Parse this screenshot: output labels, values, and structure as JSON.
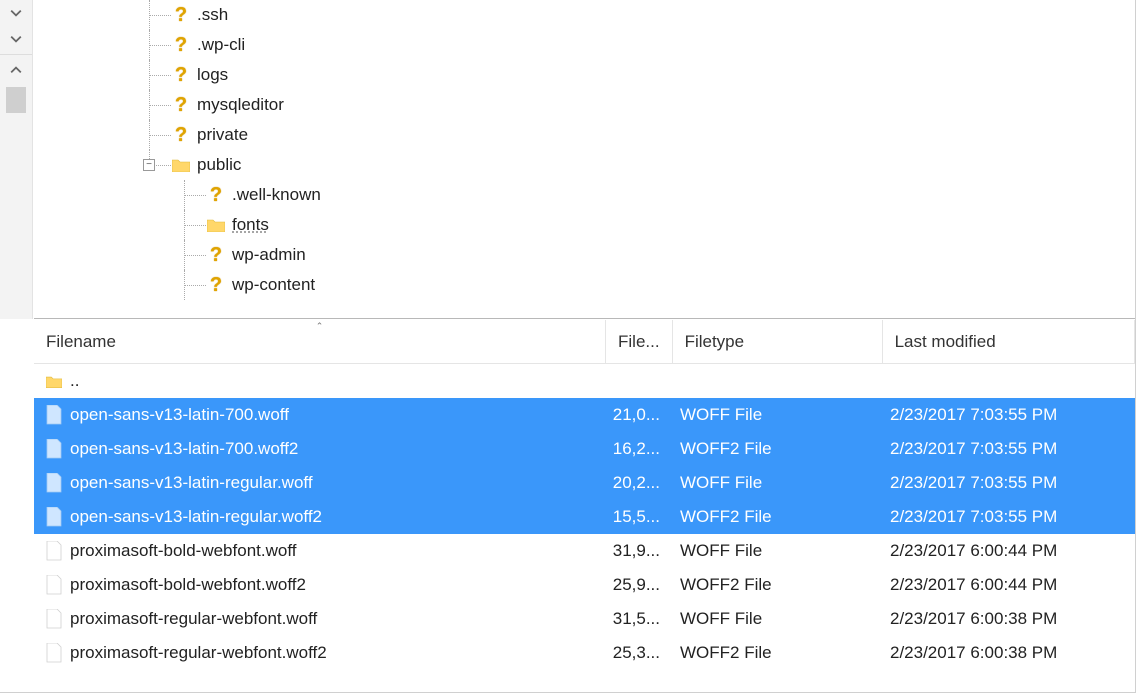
{
  "gutter": {
    "scroll_down": "down",
    "scroll_up": "up"
  },
  "tree": {
    "items": [
      {
        "label": ".ssh",
        "icon": "question",
        "depth": 1,
        "parent_expanded": false,
        "selected": false
      },
      {
        "label": ".wp-cli",
        "icon": "question",
        "depth": 1,
        "parent_expanded": false,
        "selected": false
      },
      {
        "label": "logs",
        "icon": "question",
        "depth": 1,
        "parent_expanded": false,
        "selected": false
      },
      {
        "label": "mysqleditor",
        "icon": "question",
        "depth": 1,
        "parent_expanded": false,
        "selected": false
      },
      {
        "label": "private",
        "icon": "question",
        "depth": 1,
        "parent_expanded": false,
        "selected": false
      },
      {
        "label": "public",
        "icon": "folder",
        "depth": 1,
        "parent_expanded": true,
        "selected": false,
        "toggle": "−"
      },
      {
        "label": ".well-known",
        "icon": "question",
        "depth": 2,
        "parent_expanded": false,
        "selected": false
      },
      {
        "label": "fonts",
        "icon": "folder",
        "depth": 2,
        "parent_expanded": false,
        "selected": true
      },
      {
        "label": "wp-admin",
        "icon": "question",
        "depth": 2,
        "parent_expanded": false,
        "selected": false
      },
      {
        "label": "wp-content",
        "icon": "question",
        "depth": 2,
        "parent_expanded": false,
        "selected": false
      }
    ]
  },
  "list": {
    "columns": {
      "filename": "Filename",
      "filesize": "File...",
      "filetype": "Filetype",
      "modified": "Last modified",
      "sort_indicator": "⌃"
    },
    "parent_dir": "..",
    "rows": [
      {
        "name": "open-sans-v13-latin-700.woff",
        "size": "21,0...",
        "type": "WOFF File",
        "date": "2/23/2017 7:03:55 PM",
        "selected": true,
        "blue": true
      },
      {
        "name": "open-sans-v13-latin-700.woff2",
        "size": "16,2...",
        "type": "WOFF2 File",
        "date": "2/23/2017 7:03:55 PM",
        "selected": true,
        "blue": true
      },
      {
        "name": "open-sans-v13-latin-regular.woff",
        "size": "20,2...",
        "type": "WOFF File",
        "date": "2/23/2017 7:03:55 PM",
        "selected": true,
        "blue": true
      },
      {
        "name": "open-sans-v13-latin-regular.woff2",
        "size": "15,5...",
        "type": "WOFF2 File",
        "date": "2/23/2017 7:03:55 PM",
        "selected": true,
        "blue": true
      },
      {
        "name": "proximasoft-bold-webfont.woff",
        "size": "31,9...",
        "type": "WOFF File",
        "date": "2/23/2017 6:00:44 PM",
        "selected": false,
        "blue": false
      },
      {
        "name": "proximasoft-bold-webfont.woff2",
        "size": "25,9...",
        "type": "WOFF2 File",
        "date": "2/23/2017 6:00:44 PM",
        "selected": false,
        "blue": false
      },
      {
        "name": "proximasoft-regular-webfont.woff",
        "size": "31,5...",
        "type": "WOFF File",
        "date": "2/23/2017 6:00:38 PM",
        "selected": false,
        "blue": false
      },
      {
        "name": "proximasoft-regular-webfont.woff2",
        "size": "25,3...",
        "type": "WOFF2 File",
        "date": "2/23/2017 6:00:38 PM",
        "selected": false,
        "blue": false
      }
    ]
  }
}
